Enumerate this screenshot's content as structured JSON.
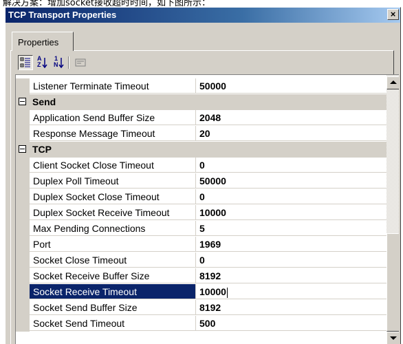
{
  "caption": "解决方案：增加socket接收超时时间，如下图所示：",
  "window": {
    "title": "TCP Transport Properties",
    "close_glyph": "×"
  },
  "tab": {
    "label": "Properties"
  },
  "toolbar": {
    "buttons": [
      {
        "icon": "categorized-icon",
        "active": true
      },
      {
        "icon": "sort-alphabetical-icon",
        "active": false
      },
      {
        "icon": "sort-numeric-icon",
        "active": false
      },
      {
        "icon": "property-pages-icon",
        "active": false
      }
    ],
    "alpha_top": "A",
    "alpha_bottom": "Z",
    "num_top": "1",
    "num_bottom": "N"
  },
  "grid": {
    "rows": [
      {
        "type": "prop",
        "name": "Listener Terminate Timeout",
        "value": "50000"
      },
      {
        "type": "cat",
        "name": "Send"
      },
      {
        "type": "prop",
        "name": "Application Send Buffer Size",
        "value": "2048"
      },
      {
        "type": "prop",
        "name": "Response Message Timeout",
        "value": "20"
      },
      {
        "type": "cat",
        "name": "TCP"
      },
      {
        "type": "prop",
        "name": "Client Socket Close Timeout",
        "value": "0"
      },
      {
        "type": "prop",
        "name": "Duplex Poll Timeout",
        "value": "50000"
      },
      {
        "type": "prop",
        "name": "Duplex Socket Close Timeout",
        "value": "0"
      },
      {
        "type": "prop",
        "name": "Duplex Socket Receive Timeout",
        "value": "10000"
      },
      {
        "type": "prop",
        "name": "Max Pending Connections",
        "value": "5"
      },
      {
        "type": "prop",
        "name": "Port",
        "value": "1969"
      },
      {
        "type": "prop",
        "name": "Socket Close Timeout",
        "value": "0"
      },
      {
        "type": "prop",
        "name": "Socket Receive Buffer Size",
        "value": "8192"
      },
      {
        "type": "prop",
        "name": "Socket Receive Timeout",
        "value": "10000",
        "selected": true
      },
      {
        "type": "prop",
        "name": "Socket Send Buffer Size",
        "value": "8192"
      },
      {
        "type": "prop",
        "name": "Socket Send Timeout",
        "value": "500"
      }
    ]
  },
  "colors": {
    "selection": "#0a246a",
    "face": "#d4d0c8",
    "title_start": "#0a246a",
    "title_end": "#a6caf0"
  }
}
